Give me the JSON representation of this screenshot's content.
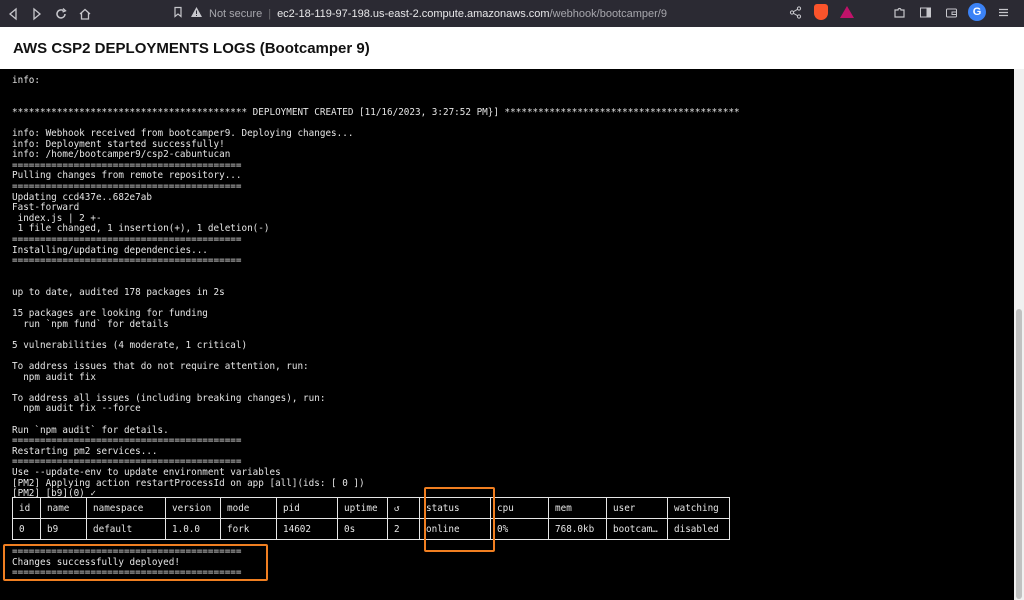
{
  "browser": {
    "not_secure": "Not secure",
    "url_host": "ec2-18-119-97-198.us-east-2.compute.amazonaws.com",
    "url_path": "/webhook/bootcamper/9",
    "profile_letter": "G"
  },
  "page": {
    "title": "AWS CSP2 DEPLOYMENTS LOGS (Bootcamper 9)"
  },
  "log_lines": [
    "info:",
    "",
    "",
    "****************************************** DEPLOYMENT CREATED [11/16/2023, 3:27:52 PM}] ******************************************",
    "",
    "info: Webhook received from bootcamper9. Deploying changes...",
    "info: Deployment started successfully!",
    "info: /home/bootcamper9/csp2-cabuntucan",
    "=========================================",
    "Pulling changes from remote repository...",
    "=========================================",
    "Updating ccd437e..682e7ab",
    "Fast-forward",
    " index.js | 2 +-",
    " 1 file changed, 1 insertion(+), 1 deletion(-)",
    "=========================================",
    "Installing/updating dependencies...",
    "=========================================",
    "",
    "",
    "up to date, audited 178 packages in 2s",
    "",
    "15 packages are looking for funding",
    "  run `npm fund` for details",
    "",
    "5 vulnerabilities (4 moderate, 1 critical)",
    "",
    "To address issues that do not require attention, run:",
    "  npm audit fix",
    "",
    "To address all issues (including breaking changes), run:",
    "  npm audit fix --force",
    "",
    "Run `npm audit` for details.",
    "=========================================",
    "Restarting pm2 services...",
    "=========================================",
    "Use --update-env to update environment variables",
    "[PM2] Applying action restartProcessId on app [all](ids: [ 0 ])",
    "[PM2] [b9](0) ✓"
  ],
  "pm2_table": {
    "headers": [
      "id",
      "name",
      "namespace",
      "version",
      "mode",
      "pid",
      "uptime",
      "↺",
      "status",
      "cpu",
      "mem",
      "user",
      "watching"
    ],
    "row": [
      "0",
      "b9",
      "default",
      "1.0.0",
      "fork",
      "14602",
      "0s",
      "2",
      "online",
      "0%",
      "768.0kb",
      "bootcam…",
      "disabled"
    ]
  },
  "footer_lines": [
    "=========================================",
    "Changes successfully deployed!",
    "========================================="
  ],
  "accent_color": "#f07f21"
}
